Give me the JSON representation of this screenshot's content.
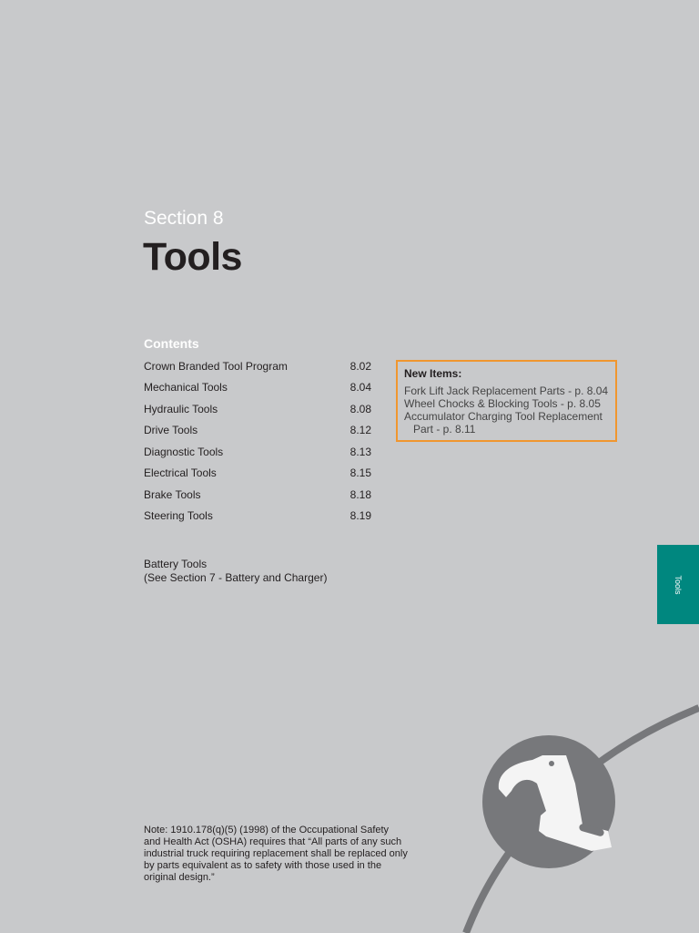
{
  "header": {
    "section": "Section 8",
    "title": "Tools"
  },
  "contents": {
    "heading": "Contents",
    "items": [
      {
        "label": "Crown Branded Tool Program",
        "page": "8.02"
      },
      {
        "label": "Mechanical Tools",
        "page": "8.04"
      },
      {
        "label": "Hydraulic Tools",
        "page": "8.08"
      },
      {
        "label": "Drive Tools",
        "page": "8.12"
      },
      {
        "label": "Diagnostic Tools",
        "page": "8.13"
      },
      {
        "label": "Electrical Tools",
        "page": "8.15"
      },
      {
        "label": "Brake Tools",
        "page": "8.18"
      },
      {
        "label": "Steering Tools",
        "page": "8.19"
      }
    ],
    "battery_line1": "Battery Tools",
    "battery_line2": "(See Section 7 - Battery and Charger)"
  },
  "new_items": {
    "heading": "New Items:",
    "lines": [
      "Fork Lift Jack Replacement Parts - p. 8.04",
      "Wheel Chocks & Blocking Tools - p. 8.05",
      "Accumulator Charging Tool Replacement",
      "Part - p. 8.11"
    ]
  },
  "side_tab": {
    "label": "Tools"
  },
  "note": "Note: 1910.178(q)(5) (1998) of the Occupational Safety and Health Act (OSHA) requires that “All parts of any such industrial truck requiring replacement shall be replaced only by parts equivalent as to safety with those used in the original design.”",
  "colors": {
    "background": "#c8c9cb",
    "accent": "#00877f",
    "box_border": "#f0962f",
    "graphic": "#77787b"
  }
}
